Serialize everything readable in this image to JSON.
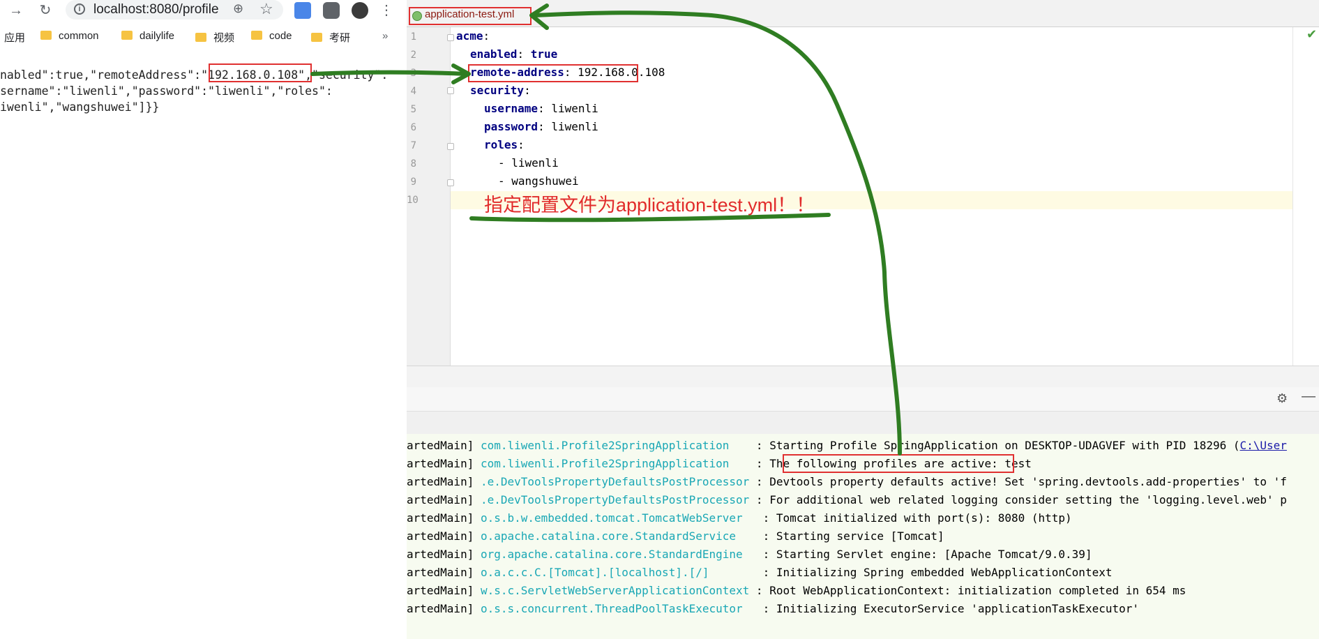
{
  "browser": {
    "url": "localhost:8080/profile",
    "bookmarks": [
      "应用",
      "common",
      "dailylife",
      "视频",
      "code",
      "考研"
    ],
    "more": "»",
    "json_lines": [
      "nabled\":true,\"remoteAddress\":\"192.168.0.108\",\"security\":",
      "sername\":\"liwenli\",\"password\":\"liwenli\",\"roles\":",
      "iwenli\",\"wangshuwei\"]}}"
    ]
  },
  "ide": {
    "tab_name": "application-test.yml",
    "line_numbers": [
      "1",
      "2",
      "3",
      "4",
      "5",
      "6",
      "7",
      "8",
      "9",
      "10"
    ],
    "yaml": {
      "l1_key": "acme",
      "l2_key": "enabled",
      "l2_val": "true",
      "l3_key": "remote-address",
      "l3_val": "192.168.0.108",
      "l4_key": "security",
      "l5_key": "username",
      "l5_val": "liwenli",
      "l6_key": "password",
      "l6_val": "liwenli",
      "l7_key": "roles",
      "l8_val": "- liwenli",
      "l9_val": "- wangshuwei"
    },
    "annotation": "指定配置文件为application-test.yml！！",
    "console": [
      {
        "thread": "artedMain]",
        "logger": "com.liwenli.Profile2SpringApplication   ",
        "msg": ": Starting Profile SpringApplication on DESKTOP-UDAGVEF with PID 18296 (",
        "link": "C:\\User"
      },
      {
        "thread": "artedMain]",
        "logger": "com.liwenli.Profile2SpringApplication   ",
        "msg": ": The following profiles are active: test",
        "link": ""
      },
      {
        "thread": "artedMain]",
        "logger": ".e.DevToolsPropertyDefaultsPostProcessor",
        "msg": ": Devtools property defaults active! Set 'spring.devtools.add-properties' to 'f",
        "link": ""
      },
      {
        "thread": "artedMain]",
        "logger": ".e.DevToolsPropertyDefaultsPostProcessor",
        "msg": ": For additional web related logging consider setting the 'logging.level.web' p",
        "link": ""
      },
      {
        "thread": "artedMain]",
        "logger": "o.s.b.w.embedded.tomcat.TomcatWebServer  ",
        "msg": ": Tomcat initialized with port(s): 8080 (http)",
        "link": ""
      },
      {
        "thread": "artedMain]",
        "logger": "o.apache.catalina.core.StandardService   ",
        "msg": ": Starting service [Tomcat]",
        "link": ""
      },
      {
        "thread": "artedMain]",
        "logger": "org.apache.catalina.core.StandardEngine  ",
        "msg": ": Starting Servlet engine: [Apache Tomcat/9.0.39]",
        "link": ""
      },
      {
        "thread": "artedMain]",
        "logger": "o.a.c.c.C.[Tomcat].[localhost].[/]       ",
        "msg": ": Initializing Spring embedded WebApplicationContext",
        "link": ""
      },
      {
        "thread": "artedMain]",
        "logger": "w.s.c.ServletWebServerApplicationContext",
        "msg": ": Root WebApplicationContext: initialization completed in 654 ms",
        "link": ""
      },
      {
        "thread": "artedMain]",
        "logger": "o.s.s.concurrent.ThreadPoolTaskExecutor  ",
        "msg": ": Initializing ExecutorService 'applicationTaskExecutor'",
        "link": ""
      }
    ]
  },
  "colors": {
    "highlight": "#e03030",
    "arrow": "#2f7d22",
    "annotation": "#e12b2b",
    "logger": "#19a7b5",
    "yaml_key": "#000080"
  }
}
